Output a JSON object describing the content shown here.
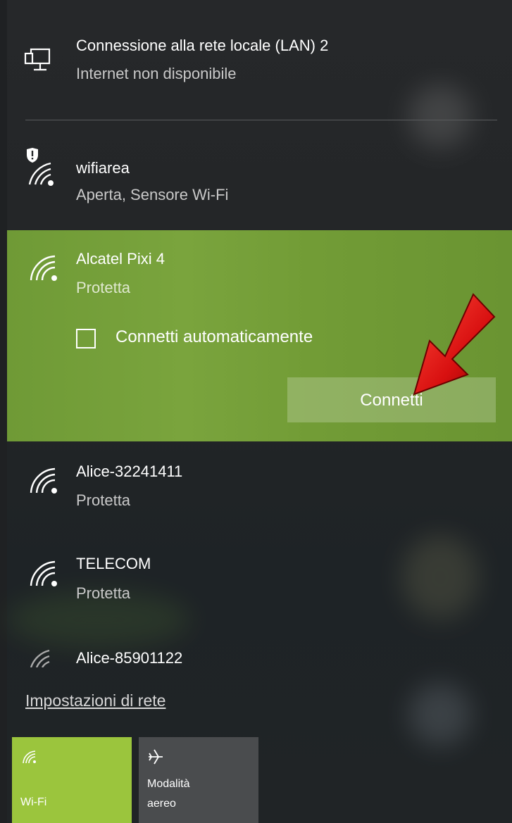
{
  "lan": {
    "title": "Connessione alla rete locale (LAN) 2",
    "status": "Internet non disponibile",
    "icon": "ethernet-monitor-icon"
  },
  "networks": [
    {
      "name": "wifiarea",
      "status": "Aperta, Sensore Wi-Fi",
      "icon": "wifi-shield-icon"
    },
    {
      "name": "Alcatel Pixi 4",
      "status": "Protetta",
      "icon": "wifi-signal-icon"
    },
    {
      "name": "Alice-32241411",
      "status": "Protetta",
      "icon": "wifi-signal-icon"
    },
    {
      "name": "TELECOM",
      "status": "Protetta",
      "icon": "wifi-signal-icon"
    },
    {
      "name": "Alice-85901122",
      "status": "",
      "icon": "wifi-signal-weak-icon"
    }
  ],
  "selected_network": {
    "auto_connect_label": "Connetti automaticamente",
    "auto_connect_checked": false,
    "connect_label": "Connetti"
  },
  "settings_link": "Impostazioni di rete",
  "quick_actions": [
    {
      "label": "Wi-Fi",
      "icon": "wifi-icon",
      "active": true
    },
    {
      "label": "Modalità aereo",
      "label_line1": "Modalità",
      "label_line2": "aereo",
      "icon": "airplane-icon",
      "active": false
    }
  ],
  "colors": {
    "accent": "#9bc53d",
    "selected_bg": "#76a03a",
    "panel_bg": "#242628",
    "arrow": "#e31b1b"
  }
}
